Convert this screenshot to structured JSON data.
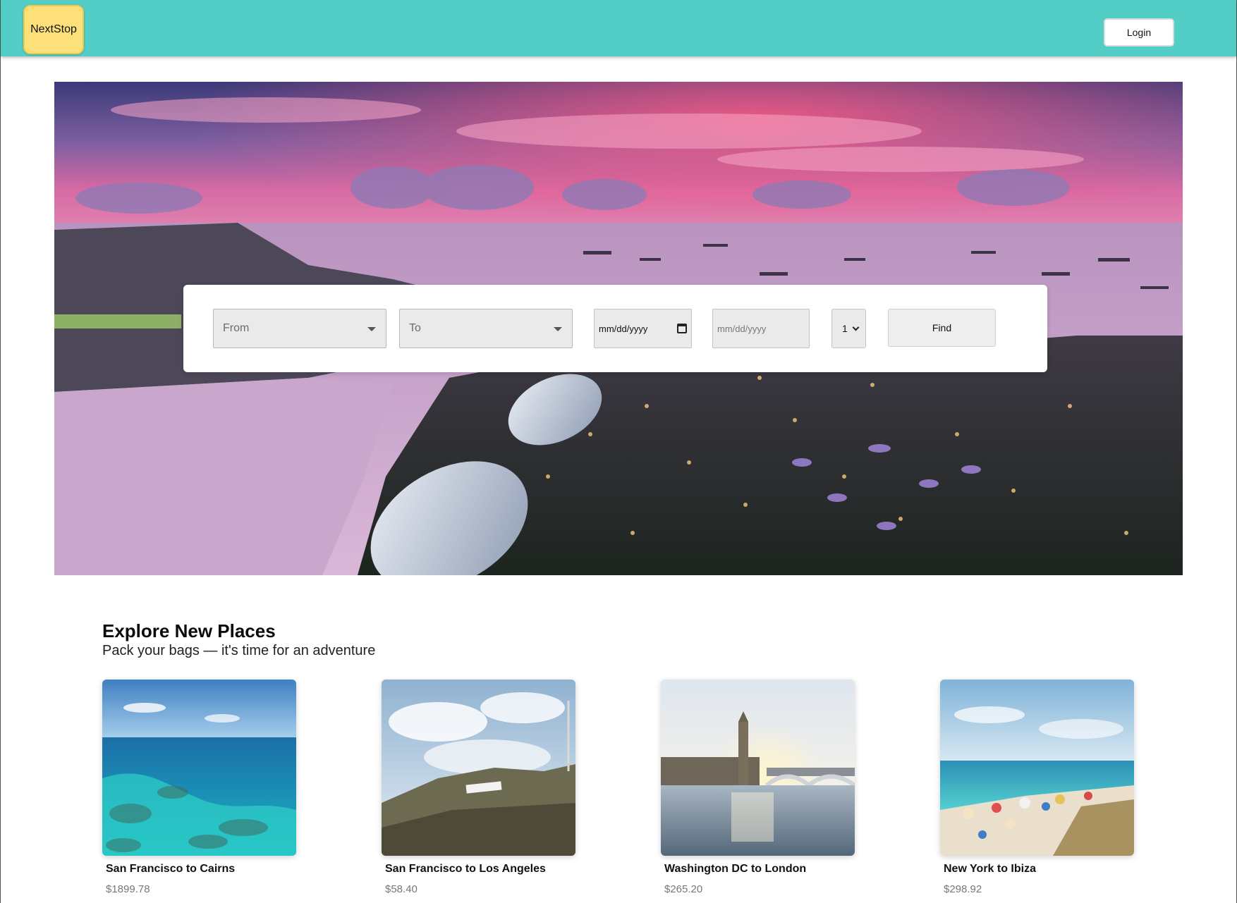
{
  "header": {
    "logo_text": "NextStop",
    "login_label": "Login",
    "background_color": "#52cec6",
    "logo_color": "#fde07a"
  },
  "search": {
    "from_placeholder": "From",
    "to_placeholder": "To",
    "depart_date_placeholder": "mm/dd/yyyy",
    "return_date_placeholder": "mm/dd/yyyy",
    "passengers_value": "1",
    "find_label": "Find"
  },
  "explore": {
    "title": "Explore New Places",
    "subtitle": "Pack your bags — it's time for an adventure",
    "cards": [
      {
        "route": "San Francisco to Cairns",
        "price": "$1899.78"
      },
      {
        "route": "San Francisco to Los Angeles",
        "price": "$58.40"
      },
      {
        "route": "Washington DC to London",
        "price": "$265.20"
      },
      {
        "route": "New York to Ibiza",
        "price": "$298.92"
      }
    ]
  }
}
